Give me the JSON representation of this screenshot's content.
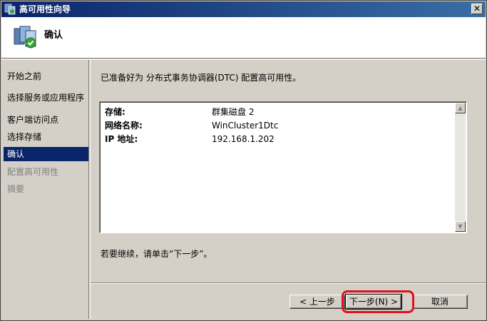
{
  "window": {
    "title": "高可用性向导",
    "close_glyph": "✕"
  },
  "header": {
    "title": "确认"
  },
  "sidebar": {
    "items": [
      {
        "label": "开始之前",
        "state": "normal"
      },
      {
        "label": "选择服务或应用程序",
        "state": "normal"
      },
      {
        "label": "客户端访问点",
        "state": "normal"
      },
      {
        "label": "选择存储",
        "state": "normal"
      },
      {
        "label": "确认",
        "state": "active"
      },
      {
        "label": "配置高可用性",
        "state": "disabled"
      },
      {
        "label": "摘要",
        "state": "disabled"
      }
    ]
  },
  "main": {
    "intro": "已准备好为 分布式事务协调器(DTC) 配置高可用性。",
    "details": [
      {
        "key": "存储:",
        "value": "群集磁盘 2"
      },
      {
        "key": "网络名称:",
        "value": "WinCluster1Dtc"
      },
      {
        "key": "IP 地址:",
        "value": "192.168.1.202"
      }
    ],
    "continue_text": "若要继续，请单击“下一步”。"
  },
  "footer": {
    "back_label": "< 上一步",
    "next_label": "下一步(N) >",
    "cancel_label": "取消"
  },
  "colors": {
    "titlebar": "#0a246a",
    "selection": "#0a246a",
    "highlight_ring": "#e0101c"
  },
  "icons": {
    "title": "cluster-wizard-icon",
    "header": "cluster-wizard-icon"
  }
}
